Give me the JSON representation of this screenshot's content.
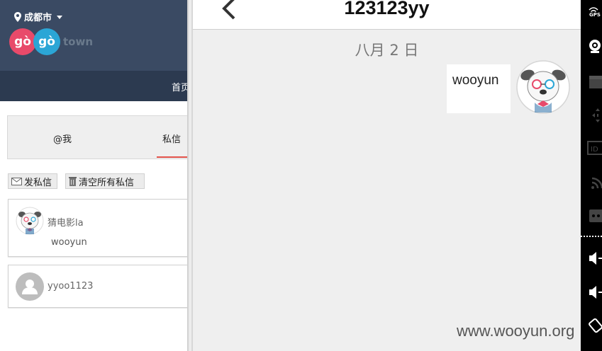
{
  "left_page": {
    "city": "成都市",
    "logo": {
      "part1": "gò",
      "part2": "gò",
      "suffix": "town"
    },
    "nav_home": "首页",
    "tabs": {
      "at_me": "@我",
      "private_msg": "私信"
    },
    "buttons": {
      "send": "发私信",
      "clear": "清空所有私信"
    },
    "conversations": [
      {
        "name": "猜电影la",
        "last_message": "wooyun",
        "avatar": "dog-avatar"
      },
      {
        "name": "yyoo1123",
        "avatar": "default-user-avatar"
      }
    ],
    "colors": {
      "header": "#3a4a63",
      "nav": "#2c3a50",
      "tab_active": "#e2524a"
    }
  },
  "chat": {
    "title": "123123yy",
    "date": "八月 2 日",
    "messages": [
      {
        "text": "wooyun",
        "side": "right",
        "avatar": "dog-avatar"
      }
    ],
    "watermark": "www.wooyun.org"
  },
  "sidebar": {
    "gps_label": "GPS",
    "icons": [
      "gps-icon",
      "webcam-icon",
      "clapper-icon",
      "move-icon",
      "id-icon",
      "rss-icon",
      "more-icon",
      "volume-up-icon",
      "volume-down-icon",
      "rotate-icon"
    ]
  }
}
